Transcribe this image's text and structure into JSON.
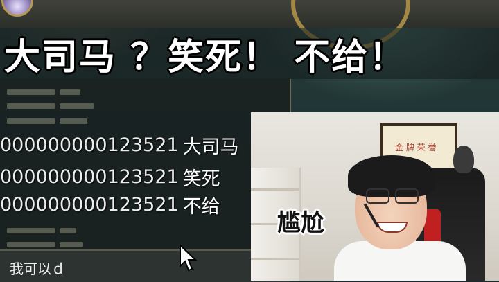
{
  "caption": {
    "text": "大司马 ？笑死！ 不给！"
  },
  "chat": {
    "lines": [
      {
        "id": "000000000123521",
        "message": "大司马"
      },
      {
        "id": "000000000123521",
        "message": "笑死"
      },
      {
        "id": "000000000123521",
        "message": "不给"
      }
    ],
    "input_value": "我可以ｄ"
  },
  "webcam": {
    "caption": "尴尬",
    "certificate_text": "金 牌 荣 誉"
  },
  "colors": {
    "caption_text": "#ffffff",
    "chat_text": "#ededed",
    "frame_gold": "#a38745"
  },
  "icons": [
    "mouse-cursor-icon",
    "avatar-icon"
  ]
}
